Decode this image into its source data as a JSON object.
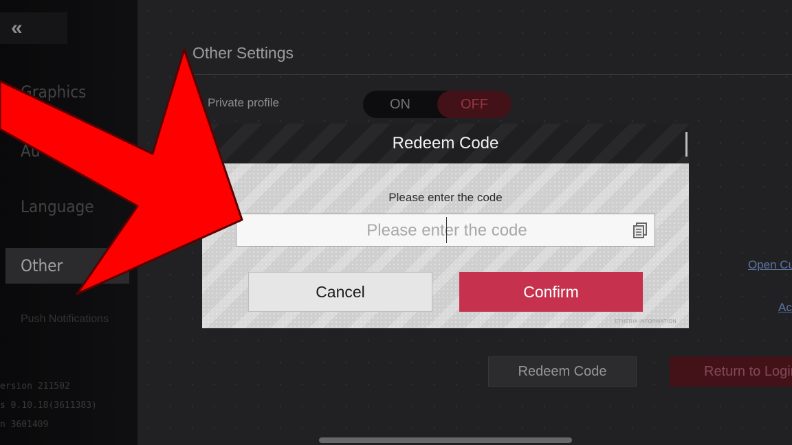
{
  "sidebar": {
    "back_glyph": "«",
    "items": [
      {
        "label": "Graphics"
      },
      {
        "label": "Au"
      },
      {
        "label": "Language"
      },
      {
        "label": "Other"
      },
      {
        "label": "Push Notifications"
      }
    ],
    "version_lines": [
      "ersion 211502",
      "s 0.10.18(3611383)",
      "n 3601409"
    ]
  },
  "main": {
    "section_title": "Other Settings",
    "private_profile": {
      "label": "Private profile",
      "on_label": "ON",
      "off_label": "OFF",
      "value": "OFF"
    },
    "open_link": "Open Cus",
    "acc_link": "Acc",
    "redeem_button": "Redeem Code",
    "return_button": "Return to Login"
  },
  "modal": {
    "title": "Redeem Code",
    "prompt": "Please enter the code",
    "input_value": "",
    "input_placeholder": "Please enter the code",
    "cancel_label": "Cancel",
    "confirm_label": "Confirm",
    "watermark": "ETHERIA INFORMATION"
  },
  "colors": {
    "accent_red": "#c6324e",
    "arrow_red": "#ff0000",
    "background": "#2b2b2e"
  }
}
